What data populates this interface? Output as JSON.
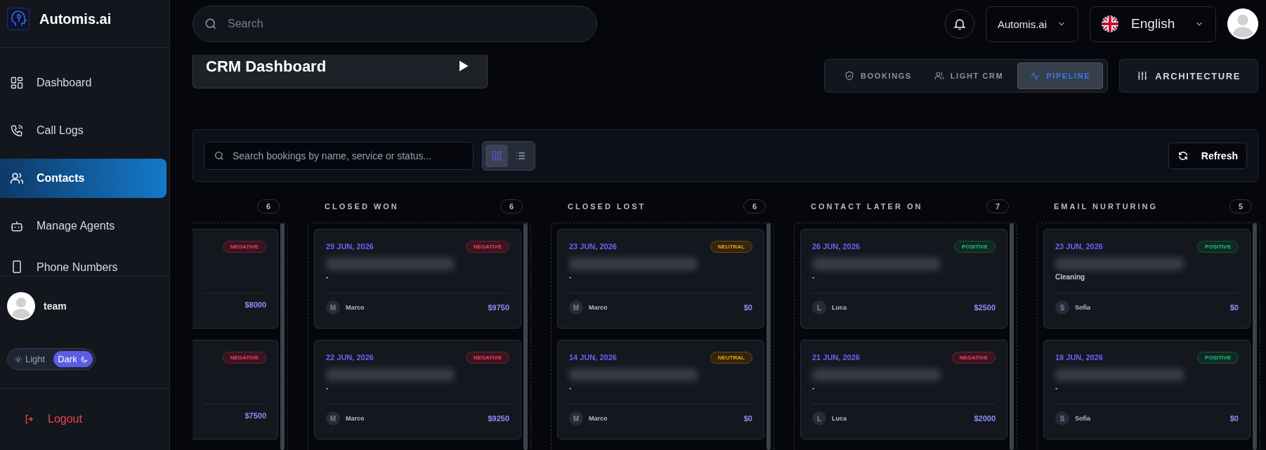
{
  "brand": {
    "name": "Automis.ai"
  },
  "nav": [
    {
      "label": "Dashboard",
      "kind": "grid",
      "selected": false
    },
    {
      "label": "Call Logs",
      "kind": "phone",
      "selected": false
    },
    {
      "label": "Contacts",
      "kind": "users",
      "selected": true
    },
    {
      "label": "Manage Agents",
      "kind": "bot",
      "selected": false
    },
    {
      "label": "Phone Numbers",
      "kind": "device",
      "selected": false
    }
  ],
  "user": {
    "name": "team"
  },
  "theme_toggle": [
    {
      "label": "Light",
      "kind": "sun",
      "selected": false
    },
    {
      "label": "Dark",
      "kind": "moon",
      "selected": true
    }
  ],
  "logout": "Logout",
  "search": {
    "placeholder": "Search"
  },
  "workspace": "Automis.ai",
  "language": "English",
  "page_title": "CRM Dashboard",
  "view_tabs": [
    {
      "label": "BOOKINGS",
      "kind": "shield",
      "selected": false
    },
    {
      "label": "LIGHT CRM",
      "kind": "users",
      "selected": false
    },
    {
      "label": "PIPELINE",
      "kind": "pulse",
      "selected": true
    }
  ],
  "architecture_button": "ARCHITECTURE",
  "board_search": {
    "placeholder": "Search bookings by name, service or status..."
  },
  "view_modes": [
    {
      "kind": "grid",
      "selected": true
    },
    {
      "kind": "list",
      "selected": false
    }
  ],
  "refresh_button": "Refresh",
  "columns": [
    {
      "count": "6",
      "cards": [
        {
          "badge": "NEGATIVE",
          "kind": "negative",
          "amount": "$8000"
        },
        {
          "badge": "NEGATIVE",
          "kind": "negative",
          "amount": "$7500"
        }
      ]
    },
    {
      "title": "CLOSED WON",
      "count": "6",
      "cards": [
        {
          "date": "29 JUN, 2026",
          "badge": "NEGATIVE",
          "kind": "negative",
          "service": "-",
          "agent_initial": "M",
          "agent": "Marco",
          "amount": "$9750"
        },
        {
          "date": "22 JUN, 2026",
          "badge": "NEGATIVE",
          "kind": "negative",
          "service": "-",
          "agent_initial": "M",
          "agent": "Marco",
          "amount": "$9250"
        }
      ]
    },
    {
      "title": "CLOSED LOST",
      "count": "6",
      "cards": [
        {
          "date": "23 JUN, 2026",
          "badge": "NEUTRAL",
          "kind": "neutral",
          "service": "-",
          "agent_initial": "M",
          "agent": "Marco",
          "amount": "$0"
        },
        {
          "date": "14 JUN, 2026",
          "badge": "NEUTRAL",
          "kind": "neutral",
          "service": "-",
          "agent_initial": "M",
          "agent": "Marco",
          "amount": "$0"
        }
      ]
    },
    {
      "title": "CONTACT LATER ON",
      "count": "7",
      "cards": [
        {
          "date": "26 JUN, 2026",
          "badge": "POSITIVE",
          "kind": "positive",
          "service": "-",
          "agent_initial": "L",
          "agent": "Luca",
          "amount": "$2500"
        },
        {
          "date": "21 JUN, 2026",
          "badge": "NEGATIVE",
          "kind": "negative",
          "service": "-",
          "agent_initial": "L",
          "agent": "Luca",
          "amount": "$2000"
        }
      ]
    },
    {
      "title": "EMAIL NURTURING",
      "count": "5",
      "cards": [
        {
          "date": "23 JUN, 2026",
          "badge": "POSITIVE",
          "kind": "positive",
          "service": "Cleaning",
          "agent_initial": "S",
          "agent": "Sofia",
          "amount": "$0"
        },
        {
          "date": "18 JUN, 2026",
          "badge": "POSITIVE",
          "kind": "positive",
          "service": "-",
          "agent_initial": "S",
          "agent": "Sofia",
          "amount": "$0"
        }
      ]
    }
  ]
}
